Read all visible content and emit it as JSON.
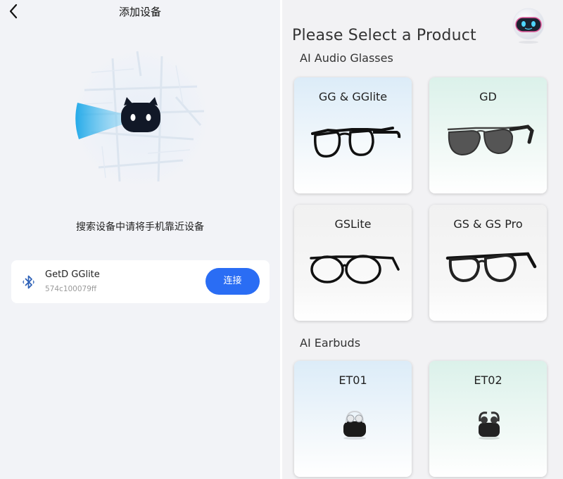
{
  "left_panel": {
    "title": "添加设备",
    "hint": "搜索设备中请将手机靠近设备",
    "device": {
      "name": "GetD GGlite",
      "id": "574c100079ff",
      "connect_label": "连接"
    }
  },
  "right_panel": {
    "title": "Please Select a Product",
    "sections": [
      {
        "title": "AI Audio Glasses",
        "products": [
          {
            "label": "GG & GGlite",
            "icon": "glasses-icon"
          },
          {
            "label": "GD",
            "icon": "aviator-sunglasses-icon"
          },
          {
            "label": "GSLite",
            "icon": "glasses-icon"
          },
          {
            "label": "GS & GS Pro",
            "icon": "glasses-icon"
          }
        ]
      },
      {
        "title": "AI Earbuds",
        "products": [
          {
            "label": "ET01",
            "icon": "earbuds-case-icon"
          },
          {
            "label": "ET02",
            "icon": "earbuds-case-icon"
          }
        ]
      }
    ]
  },
  "colors": {
    "accent": "#2a6df4",
    "left_background": "#f2f3f7",
    "right_background": "#f2f2f4",
    "card_blue": "#dcecf8",
    "card_green": "#dbf1ea"
  }
}
